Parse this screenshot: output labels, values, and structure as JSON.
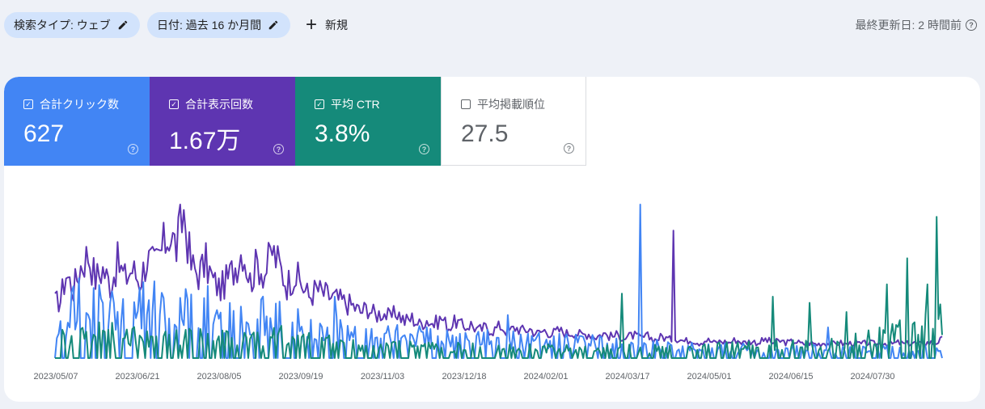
{
  "filters": {
    "search_type": "検索タイプ: ウェブ",
    "date": "日付: 過去 16 か月間",
    "new_label": "新規"
  },
  "last_updated": "最終更新日: 2 時間前",
  "metrics": [
    {
      "label": "合計クリック数",
      "value": "627",
      "checked": true,
      "color": "#4285f4"
    },
    {
      "label": "合計表示回数",
      "value": "1.67万",
      "checked": true,
      "color": "#5e35b1"
    },
    {
      "label": "平均 CTR",
      "value": "3.8%",
      "checked": true,
      "color": "#158a7a"
    },
    {
      "label": "平均掲載順位",
      "value": "27.5",
      "checked": false,
      "color": "#ffffff"
    }
  ],
  "chart_data": {
    "type": "line",
    "x_tick_labels": [
      "2023/05/07",
      "2023/06/21",
      "2023/08/05",
      "2023/09/19",
      "2023/11/03",
      "2023/12/18",
      "2024/02/01",
      "2024/03/17",
      "2024/05/01",
      "2024/06/15",
      "2024/07/30"
    ],
    "x_range": [
      "2023/05/07",
      "2024/09/01"
    ],
    "grid": false,
    "series": [
      {
        "name": "合計表示回数",
        "color": "#5e35b1",
        "note_values": "relative daily level 0-1 (y-axis unlabeled)",
        "anchors": [
          [
            0,
            0.36
          ],
          [
            3,
            0.38
          ],
          [
            6,
            0.55
          ],
          [
            10,
            0.45
          ],
          [
            14,
            0.6
          ],
          [
            18,
            0.68
          ],
          [
            22,
            0.52
          ],
          [
            26,
            0.58
          ],
          [
            30,
            0.48
          ],
          [
            34,
            0.62
          ],
          [
            38,
            0.52
          ],
          [
            42,
            0.58
          ],
          [
            46,
            0.5
          ],
          [
            50,
            0.65
          ],
          [
            54,
            0.6
          ],
          [
            58,
            0.7
          ],
          [
            62,
            0.82
          ],
          [
            66,
            0.72
          ],
          [
            70,
            0.95
          ],
          [
            74,
            0.6
          ],
          [
            78,
            0.55
          ],
          [
            82,
            0.62
          ],
          [
            86,
            0.5
          ],
          [
            90,
            0.45
          ],
          [
            94,
            0.52
          ],
          [
            98,
            0.6
          ],
          [
            102,
            0.72
          ],
          [
            106,
            0.5
          ],
          [
            110,
            0.62
          ],
          [
            114,
            0.55
          ],
          [
            118,
            0.7
          ],
          [
            122,
            0.6
          ],
          [
            126,
            0.48
          ],
          [
            130,
            0.55
          ],
          [
            134,
            0.48
          ],
          [
            138,
            0.4
          ],
          [
            142,
            0.45
          ],
          [
            146,
            0.42
          ],
          [
            150,
            0.4
          ],
          [
            154,
            0.38
          ],
          [
            158,
            0.36
          ],
          [
            162,
            0.34
          ],
          [
            166,
            0.3
          ],
          [
            170,
            0.33
          ],
          [
            174,
            0.28
          ],
          [
            178,
            0.3
          ],
          [
            182,
            0.26
          ],
          [
            186,
            0.3
          ],
          [
            190,
            0.24
          ],
          [
            194,
            0.26
          ],
          [
            198,
            0.22
          ],
          [
            202,
            0.25
          ],
          [
            206,
            0.22
          ],
          [
            210,
            0.26
          ],
          [
            214,
            0.2
          ],
          [
            218,
            0.24
          ],
          [
            222,
            0.2
          ],
          [
            226,
            0.22
          ],
          [
            230,
            0.18
          ],
          [
            234,
            0.2
          ],
          [
            238,
            0.18
          ],
          [
            242,
            0.21
          ],
          [
            246,
            0.17
          ],
          [
            250,
            0.2
          ],
          [
            254,
            0.18
          ],
          [
            258,
            0.19
          ],
          [
            262,
            0.16
          ],
          [
            266,
            0.18
          ],
          [
            270,
            0.16
          ],
          [
            274,
            0.18
          ],
          [
            278,
            0.16
          ],
          [
            282,
            0.17
          ],
          [
            286,
            0.15
          ],
          [
            290,
            0.16
          ],
          [
            294,
            0.14
          ],
          [
            298,
            0.16
          ],
          [
            302,
            0.14
          ],
          [
            306,
            0.15
          ],
          [
            310,
            0.13
          ],
          [
            314,
            0.15
          ],
          [
            318,
            0.13
          ],
          [
            322,
            0.14
          ],
          [
            326,
            0.12
          ],
          [
            330,
            0.14
          ],
          [
            334,
            0.12
          ],
          [
            338,
            0.13
          ],
          [
            342,
            0.11
          ],
          [
            346,
            0.12
          ],
          [
            350,
            0.1
          ],
          [
            354,
            0.12
          ],
          [
            358,
            0.1
          ],
          [
            362,
            0.11
          ],
          [
            366,
            0.1
          ],
          [
            370,
            0.12
          ],
          [
            374,
            0.1
          ],
          [
            378,
            0.11
          ],
          [
            382,
            0.1
          ],
          [
            386,
            0.12
          ],
          [
            390,
            0.1
          ],
          [
            394,
            0.11
          ],
          [
            398,
            0.1
          ],
          [
            402,
            0.11
          ],
          [
            406,
            0.09
          ],
          [
            410,
            0.1
          ],
          [
            414,
            0.09
          ],
          [
            418,
            0.1
          ],
          [
            422,
            0.09
          ],
          [
            426,
            0.1
          ],
          [
            430,
            0.09
          ],
          [
            434,
            0.1
          ],
          [
            438,
            0.09
          ],
          [
            442,
            0.1
          ],
          [
            446,
            0.09
          ],
          [
            450,
            0.1
          ],
          [
            454,
            0.09
          ],
          [
            458,
            0.1
          ],
          [
            462,
            0.09
          ],
          [
            466,
            0.1
          ],
          [
            470,
            0.09
          ],
          [
            474,
            0.1
          ],
          [
            478,
            0.1
          ],
          [
            482,
            0.12
          ]
        ],
        "spikes": [
          [
            336,
            0.83
          ]
        ]
      },
      {
        "name": "合計クリック数",
        "color": "#4285f4",
        "note_values": "relative daily level 0-1 (y-axis unlabeled)",
        "anchors": [
          [
            0,
            0.1
          ],
          [
            10,
            0.28
          ],
          [
            20,
            0.3
          ],
          [
            40,
            0.26
          ],
          [
            60,
            0.3
          ],
          [
            80,
            0.28
          ],
          [
            100,
            0.24
          ],
          [
            120,
            0.22
          ],
          [
            140,
            0.18
          ],
          [
            160,
            0.15
          ],
          [
            180,
            0.12
          ],
          [
            200,
            0.12
          ],
          [
            220,
            0.11
          ],
          [
            240,
            0.1
          ],
          [
            260,
            0.1
          ],
          [
            280,
            0.09
          ],
          [
            300,
            0.08
          ],
          [
            320,
            0.08
          ],
          [
            340,
            0.06
          ],
          [
            360,
            0.06
          ],
          [
            380,
            0.05
          ],
          [
            400,
            0.05
          ],
          [
            420,
            0.05
          ],
          [
            440,
            0.05
          ],
          [
            460,
            0.05
          ],
          [
            482,
            0.06
          ]
        ],
        "spikes": [
          [
            13,
            0.52
          ],
          [
            71,
            0.45
          ],
          [
            152,
            0.4
          ],
          [
            246,
            0.28
          ],
          [
            318,
            1.0
          ],
          [
            420,
            0.2
          ]
        ]
      },
      {
        "name": "平均 CTR",
        "color": "#158a7a",
        "note_values": "relative daily level 0-1 (y-axis unlabeled)",
        "anchors": [
          [
            0,
            0.1
          ],
          [
            20,
            0.14
          ],
          [
            40,
            0.12
          ],
          [
            60,
            0.1
          ],
          [
            80,
            0.12
          ],
          [
            100,
            0.1
          ],
          [
            120,
            0.12
          ],
          [
            140,
            0.1
          ],
          [
            160,
            0.08
          ],
          [
            180,
            0.07
          ],
          [
            200,
            0.06
          ],
          [
            220,
            0.06
          ],
          [
            240,
            0.05
          ],
          [
            260,
            0.06
          ],
          [
            280,
            0.05
          ],
          [
            300,
            0.05
          ],
          [
            320,
            0.05
          ],
          [
            340,
            0.05
          ],
          [
            360,
            0.06
          ],
          [
            380,
            0.06
          ],
          [
            400,
            0.07
          ],
          [
            420,
            0.08
          ],
          [
            440,
            0.1
          ],
          [
            460,
            0.14
          ],
          [
            482,
            0.22
          ]
        ],
        "spikes": [
          [
            308,
            0.42
          ],
          [
            390,
            0.4
          ],
          [
            410,
            0.36
          ],
          [
            430,
            0.3
          ],
          [
            452,
            0.48
          ],
          [
            463,
            0.65
          ],
          [
            474,
            0.48
          ],
          [
            479,
            0.92
          ],
          [
            481,
            0.35
          ]
        ]
      }
    ]
  }
}
